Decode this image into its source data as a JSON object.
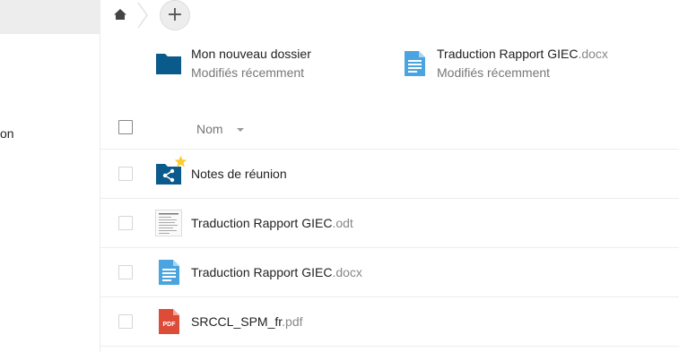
{
  "sidebar": {
    "active_item_label": "",
    "cut_label": "on"
  },
  "breadcrumb": {
    "home_icon": "home-icon",
    "add_label": "+"
  },
  "recent": [
    {
      "name": "Mon nouveau dossier",
      "ext": "",
      "subtitle": "Modifiés récemment",
      "icon": "folder-icon"
    },
    {
      "name": "Traduction Rapport GIEC",
      "ext": ".docx",
      "subtitle": "Modifiés récemment",
      "icon": "document-icon"
    }
  ],
  "list": {
    "header_name": "Nom",
    "rows": [
      {
        "name": "Notes de réunion",
        "ext": "",
        "icon": "shared-folder-icon",
        "favorite": true
      },
      {
        "name": "Traduction Rapport GIEC",
        "ext": ".odt",
        "icon": "odt-thumbnail-icon"
      },
      {
        "name": "Traduction Rapport GIEC",
        "ext": ".docx",
        "icon": "document-icon"
      },
      {
        "name": "SRCCL_SPM_fr",
        "ext": ".pdf",
        "icon": "pdf-icon",
        "icon_label": "PDF"
      }
    ]
  },
  "colors": {
    "folder": "#0b5a8c",
    "document": "#4aa4e0",
    "pdf": "#dd4b39",
    "star": "#fccc2e"
  }
}
